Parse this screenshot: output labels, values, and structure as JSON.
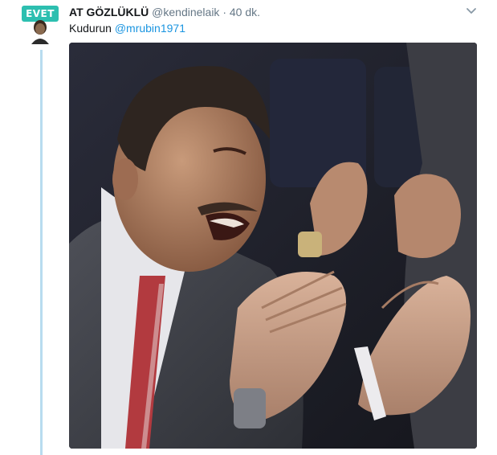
{
  "avatar": {
    "badge_text": "EVET",
    "badge_color": "#2dbfb0",
    "icon": "profile-avatar"
  },
  "tweet": {
    "author_name": "AT GÖZLÜKLÜ",
    "handle": "@kendinelaik",
    "separator": "·",
    "timestamp": "40 dk.",
    "text": "Kudurun",
    "mention": "@mrubin1971",
    "menu_icon": "chevron-down-icon"
  },
  "media": {
    "type": "photo",
    "description_icon": "photo"
  },
  "colors": {
    "accent": "#1b95e0",
    "secondary_text": "#657786",
    "thread_line": "#b8dcef",
    "primary_text": "#14171a"
  }
}
